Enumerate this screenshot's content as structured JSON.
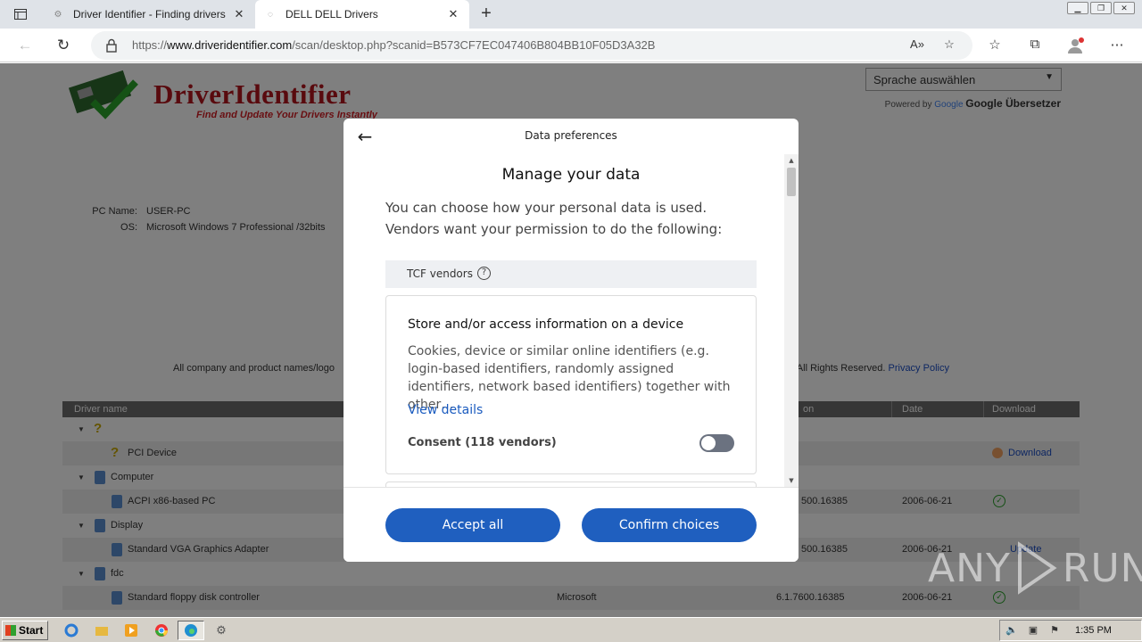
{
  "browser": {
    "tabs": [
      {
        "title": "Driver Identifier - Finding drivers",
        "active": false
      },
      {
        "title": "DELL DELL Drivers",
        "active": true
      }
    ],
    "url_prefix": "https://",
    "url_domain": "www.driveridentifier.com",
    "url_path": "/scan/desktop.php?scanid=B573CF7EC047406B804BB10F05D3A32B"
  },
  "site": {
    "logo_text": "DriverIdentifier",
    "logo_tagline": "Find and Update Your Drivers Instantly",
    "language_select": "Sprache auswählen",
    "powered_by": "Powered by",
    "google": "Google",
    "google_translate": "Google Übersetzer",
    "pc_name_label": "PC Name:",
    "pc_name": "USER-PC",
    "os_label": "OS:",
    "os": "Microsoft Windows 7 Professional /32bits",
    "footer_left": "All company and product names/logo",
    "footer_right": "ers. All Rights Reserved.",
    "privacy_policy": "Privacy Policy"
  },
  "table": {
    "headers": {
      "driver_name": "Driver name",
      "version": "on",
      "date": "Date",
      "download": "Download"
    },
    "rows": [
      {
        "type": "group",
        "label": "",
        "icon": "question-icon"
      },
      {
        "type": "item",
        "name": "PCI Device",
        "icon": "question-icon",
        "provider": "",
        "version": "",
        "date": "",
        "action": "Download"
      },
      {
        "type": "group",
        "label": "Computer"
      },
      {
        "type": "item",
        "name": "ACPI x86-based PC",
        "provider": "",
        "version": "500.16385",
        "date": "2006-06-21",
        "action": "ok"
      },
      {
        "type": "group",
        "label": "Display"
      },
      {
        "type": "item",
        "name": "Standard VGA Graphics Adapter",
        "provider": "",
        "version": "500.16385",
        "date": "2006-06-21",
        "action": "Update"
      },
      {
        "type": "group",
        "label": "fdc"
      },
      {
        "type": "item",
        "name": "Standard floppy disk controller",
        "provider": "Microsoft",
        "version": "6.1.7600.16385",
        "date": "2006-06-21",
        "action": "ok"
      }
    ]
  },
  "modal": {
    "header_title": "Data preferences",
    "heading": "Manage your data",
    "intro": "You can choose how your personal data is used. Vendors want your permission to do the following:",
    "section_label": "TCF vendors",
    "card_title": "Store and/or access information on a device",
    "card_desc": "Cookies, device or similar online identifiers (e.g. login-based identifiers, randomly assigned identifiers, network based identifiers) together with other…",
    "view_details": "View details",
    "consent_label": "Consent (118 vendors)",
    "consent_on": false,
    "accept_all": "Accept all",
    "confirm_choices": "Confirm choices"
  },
  "watermark": {
    "text_left": "ANY",
    "text_right": "RUN"
  },
  "taskbar": {
    "start": "Start",
    "clock": "1:35 PM"
  },
  "colors": {
    "accent": "#1f5fbf",
    "brand_red": "#b3141c",
    "link": "#1a5bbf"
  }
}
